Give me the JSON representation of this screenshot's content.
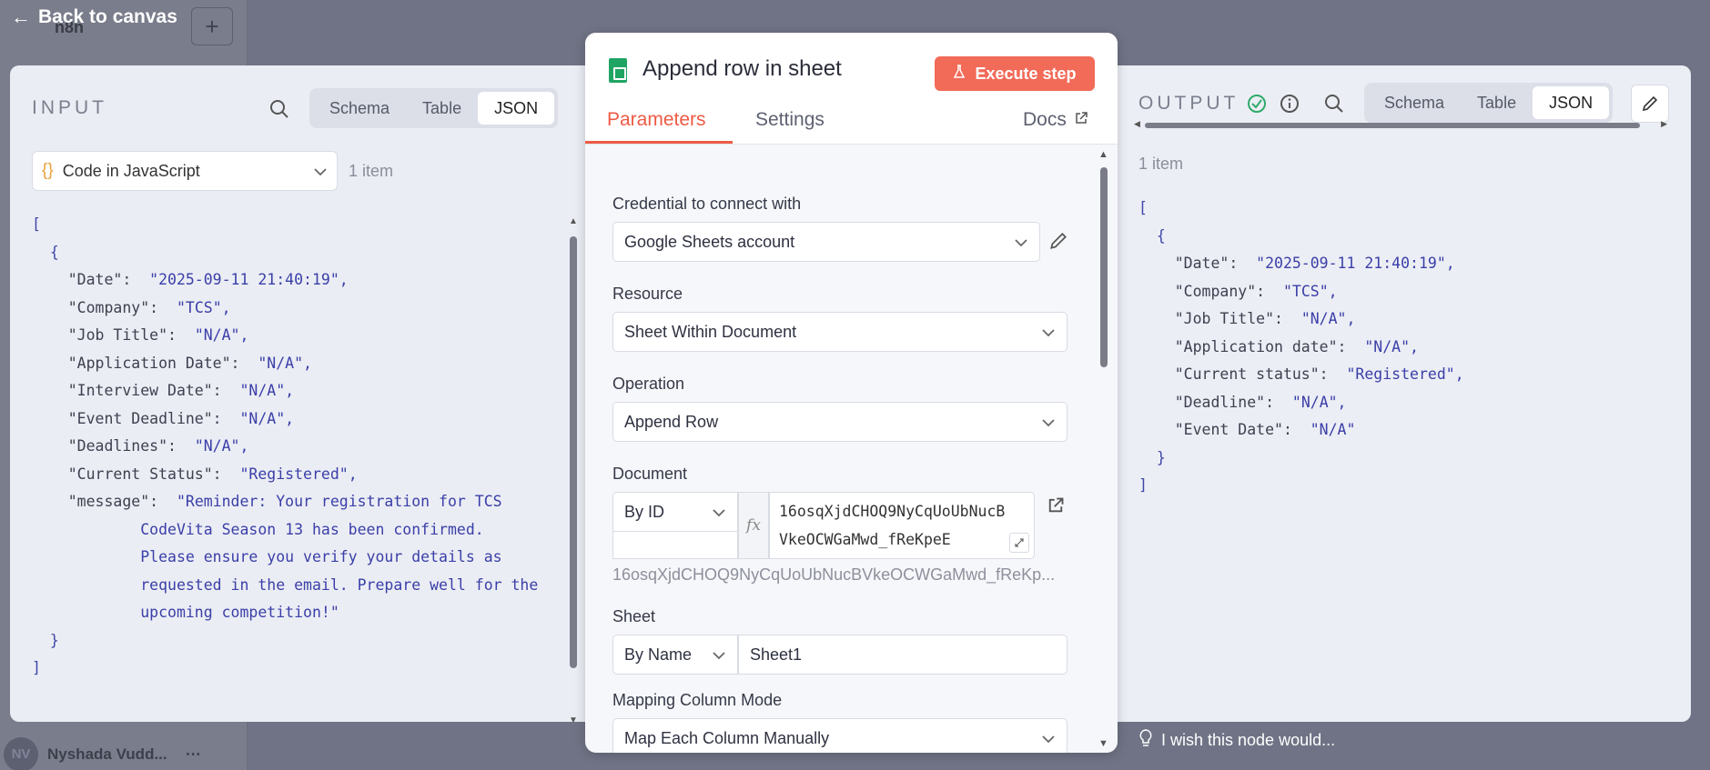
{
  "background": {
    "logo": "n8n",
    "user_initials": "NV",
    "user_name": "Nyshada Vudd...",
    "plus": "+",
    "more": "⋯"
  },
  "back_link": "Back to canvas",
  "input": {
    "label": "INPUT",
    "tabs": [
      "Schema",
      "Table",
      "JSON"
    ],
    "active_tab": "JSON",
    "node_name": "Code in JavaScript",
    "count": "1 item",
    "json_lines": [
      "[",
      "  {",
      "    \"Date\":  \"2025-09-11 21:40:19\",",
      "    \"Company\":  \"TCS\",",
      "    \"Job Title\":  \"N/A\",",
      "    \"Application Date\":  \"N/A\",",
      "    \"Interview Date\":  \"N/A\",",
      "    \"Event Deadline\":  \"N/A\",",
      "    \"Deadlines\":  \"N/A\",",
      "    \"Current Status\":  \"Registered\",",
      "    \"message\":  \"Reminder: Your registration for TCS",
      "            CodeVita Season 13 has been confirmed.",
      "            Please ensure you verify your details as",
      "            requested in the email. Prepare well for the",
      "            upcoming competition!\"",
      "  }",
      "]"
    ]
  },
  "modal": {
    "title": "Append row in sheet",
    "execute_label": "Execute step",
    "tabs": [
      "Parameters",
      "Settings"
    ],
    "active_tab": "Parameters",
    "docs_label": "Docs",
    "fields": {
      "credential_label": "Credential to connect with",
      "credential_value": "Google Sheets account",
      "resource_label": "Resource",
      "resource_value": "Sheet Within Document",
      "operation_label": "Operation",
      "operation_value": "Append Row",
      "document_label": "Document",
      "document_mode": "By ID",
      "document_id_line1": "16osqXjdCHOQ9NyCqUoUbNucB",
      "document_id_line2": "VkeOCWGaMwd_fReKpeE",
      "document_hint": "16osqXjdCHOQ9NyCqUoUbNucBVkeOCWGaMwd_fReKp...",
      "fx": "fx",
      "sheet_label": "Sheet",
      "sheet_mode": "By Name",
      "sheet_value": "Sheet1",
      "mapping_label": "Mapping Column Mode",
      "mapping_value": "Map Each Column Manually"
    }
  },
  "output": {
    "label": "OUTPUT",
    "tabs": [
      "Schema",
      "Table",
      "JSON"
    ],
    "active_tab": "JSON",
    "count": "1 item",
    "json_lines": [
      "[",
      "  {",
      "    \"Date\":  \"2025-09-11 21:40:19\",",
      "    \"Company\":  \"TCS\",",
      "    \"Job Title\":  \"N/A\",",
      "    \"Application date\":  \"N/A\",",
      "    \"Current status\":  \"Registered\",",
      "    \"Deadline\":  \"N/A\",",
      "    \"Event Date\":  \"N/A\"",
      "  }",
      "]"
    ]
  },
  "feedback": "I wish this node would...",
  "colors": {
    "accent": "#ee5a45",
    "execute_button": "#f26a58",
    "json_string": "#3a3fa8",
    "success": "#2eaa6a"
  },
  "icons": {
    "search": "search-icon",
    "check": "success-check-icon",
    "info": "info-icon",
    "pencil": "pencil-icon",
    "external": "external-link-icon",
    "chevron": "chevron-down-icon",
    "flask": "flask-icon",
    "sheets": "google-sheets-icon",
    "bulb": "lightbulb-icon"
  }
}
